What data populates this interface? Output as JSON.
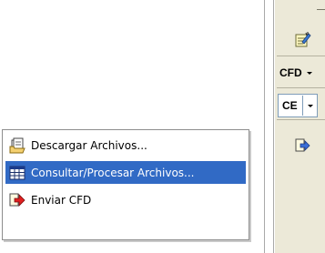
{
  "context_menu": {
    "items": [
      {
        "label": "Descargar Archivos...",
        "icon": "download-files-icon",
        "highlighted": false
      },
      {
        "label": "Consultar/Procesar Archivos...",
        "icon": "table-grid-icon",
        "highlighted": true
      },
      {
        "label": "Enviar CFD",
        "icon": "send-arrow-icon",
        "highlighted": false
      }
    ]
  },
  "toolbar": {
    "cfd_label": "CFD",
    "ce_label": "CE"
  },
  "colors": {
    "highlight": "#316ac5",
    "toolbar_bg": "#ece9d8",
    "menu_border": "#8e8e8e",
    "send_arrow": "#e02020"
  }
}
